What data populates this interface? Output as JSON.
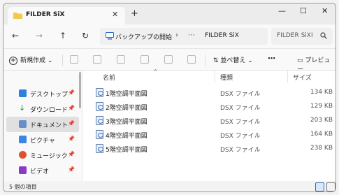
{
  "window": {
    "tab_title": "FILDER SiX"
  },
  "address": {
    "crumb_root": "バックアップの開始",
    "crumb_more": "⋯",
    "crumb_current": "FILDER SiX"
  },
  "search": {
    "placeholder": "FILDER SiXI"
  },
  "toolbar": {
    "new_label": "新規作成",
    "sort_label": "並べ替え",
    "preview_label": "プレビュー",
    "more_label": "⋯"
  },
  "sidebar": {
    "items": [
      {
        "label": "デスクトップ",
        "icon": "desktop-icon",
        "color": "#2f7ee0"
      },
      {
        "label": "ダウンロード",
        "icon": "download-icon",
        "color": "#1e8a5a"
      },
      {
        "label": "ドキュメント",
        "icon": "documents-icon",
        "color": "#6a8fc8"
      },
      {
        "label": "ピクチャ",
        "icon": "pictures-icon",
        "color": "#3a86e0"
      },
      {
        "label": "ミュージック",
        "icon": "music-icon",
        "color": "#e0502f"
      },
      {
        "label": "ビデオ",
        "icon": "video-icon",
        "color": "#8a3ac8"
      }
    ]
  },
  "columns": {
    "name": "名前",
    "type": "種類",
    "size": "サイズ"
  },
  "files": [
    {
      "name": "1階空調平面図",
      "type": "DSX ファイル",
      "size": "134 KB"
    },
    {
      "name": "2階空調平面図",
      "type": "DSX ファイル",
      "size": "129 KB"
    },
    {
      "name": "3階空調平面図",
      "type": "DSX ファイル",
      "size": "203 KB"
    },
    {
      "name": "4階空調平面図",
      "type": "DSX ファイル",
      "size": "164 KB"
    },
    {
      "name": "5階空調平面図",
      "type": "DSX ファイル",
      "size": "238 KB"
    }
  ],
  "status": {
    "count": "5 個の項目"
  },
  "colors": {
    "folder": "#f2c94c",
    "accent": "#2b6cc4"
  }
}
